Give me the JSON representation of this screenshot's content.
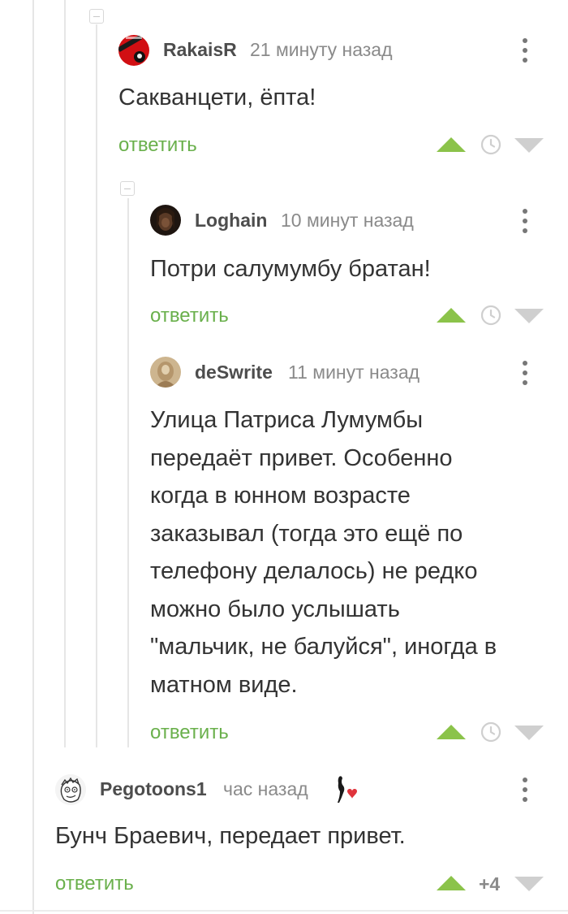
{
  "comments": [
    {
      "author": "RakaisR",
      "time": "21 минуту назад",
      "avatar_icon": "red-avatar-icon",
      "lines": [
        "Сакванцети, ёпта!"
      ],
      "reply_label": "ответить"
    },
    {
      "author": "Loghain",
      "time": "10 минут назад",
      "avatar_icon": "dark-portrait-avatar-icon",
      "lines": [
        "Потри салумумбу братан!"
      ],
      "reply_label": "ответить"
    },
    {
      "author": "deSwrite",
      "time": "11 минут назад",
      "avatar_icon": "sepia-avatar-icon",
      "lines": [
        "Улица Патриса Лумумбы",
        "передаёт привет. Особенно",
        "когда в юнном возрасте",
        "заказывал (тогда это ещё по",
        "телефону делалось) не редко",
        "можно было услышать",
        "\"мальчик, не балуйся\", иногда в",
        "матном виде."
      ],
      "reply_label": "ответить"
    },
    {
      "author": "Pegotoons1",
      "time": "час назад",
      "avatar_icon": "cartoon-face-avatar-icon",
      "badge_icon": "heart-badge-icon",
      "lines": [
        "Бунч Браевич, передает привет."
      ],
      "reply_label": "ответить",
      "rating": "+4"
    }
  ],
  "colors": {
    "accent_green": "#6ab04c",
    "upvote": "#8bc34a",
    "downvote": "#cfcfcf",
    "text": "#333333",
    "muted": "#8a8a8a"
  }
}
